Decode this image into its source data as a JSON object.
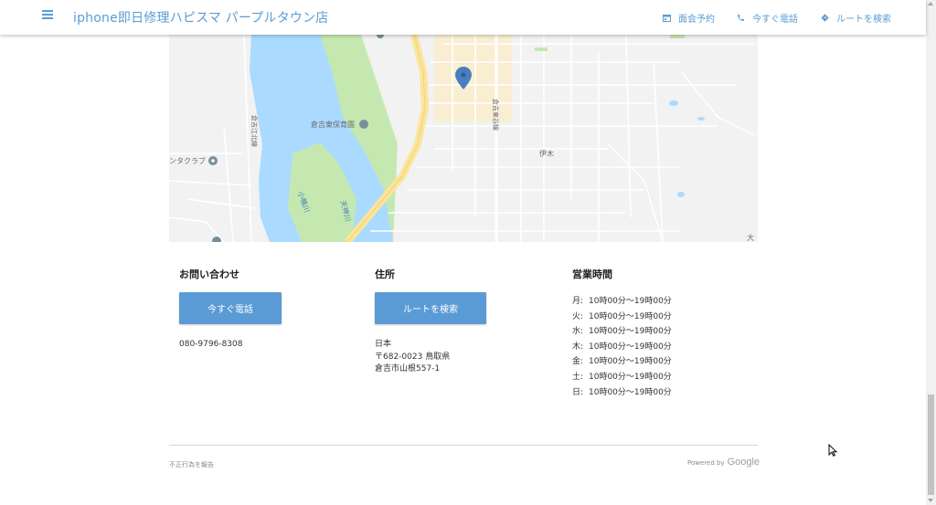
{
  "header": {
    "title": "iphone即日修理ハピスマ パープルタウン店",
    "nav": {
      "booking": "面会予約",
      "call": "今すぐ電話",
      "route": "ルートを検索"
    }
  },
  "map": {
    "labels": {
      "nursery": "倉吉東保育園",
      "club": "ンタクラブ",
      "area_iki": "伊木",
      "river_tenjin": "天神川",
      "river_ogamo": "小鴨川",
      "road1": "倉吉東谷線",
      "road2": "倉吉江北線",
      "edge": "大"
    }
  },
  "contact": {
    "title": "お問い合わせ",
    "button": "今すぐ電話",
    "phone": "080-9796-8308"
  },
  "address": {
    "title": "住所",
    "button": "ルートを検索",
    "lines": [
      "日本",
      "〒682-0023 鳥取県",
      "倉吉市山根557-1"
    ]
  },
  "hours": {
    "title": "営業時間",
    "rows": [
      {
        "day": "月:",
        "time": "10時00分～19時00分"
      },
      {
        "day": "火:",
        "time": "10時00分～19時00分"
      },
      {
        "day": "水:",
        "time": "10時00分～19時00分"
      },
      {
        "day": "木:",
        "time": "10時00分～19時00分"
      },
      {
        "day": "金:",
        "time": "10時00分～19時00分"
      },
      {
        "day": "土:",
        "time": "10時00分～19時00分"
      },
      {
        "day": "日:",
        "time": "10時00分～19時00分"
      }
    ]
  },
  "footer": {
    "report": "不正行為を報告",
    "powered_by": "Powered by",
    "brand": "Google"
  },
  "colors": {
    "accent": "#5b9bd5",
    "water": "#aadaff",
    "park": "#c5e8b0",
    "highway": "#fbe59a",
    "highlight_area": "#f9eed2"
  }
}
